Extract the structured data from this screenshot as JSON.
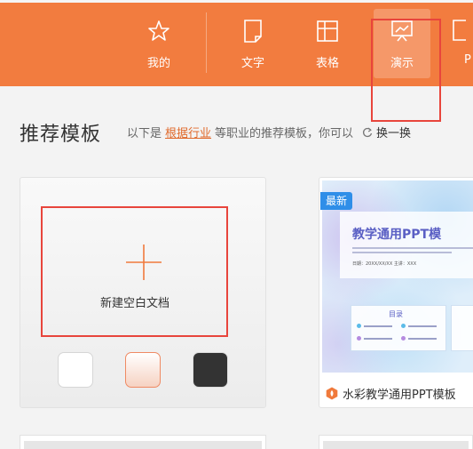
{
  "nav": {
    "items": [
      {
        "label": "我的",
        "icon": "star-icon"
      },
      {
        "label": "文字",
        "icon": "document-icon"
      },
      {
        "label": "表格",
        "icon": "table-icon"
      },
      {
        "label": "演示",
        "icon": "presentation-icon",
        "active": true
      },
      {
        "label": "P",
        "icon": "pdf-icon"
      }
    ]
  },
  "header": {
    "title": "推荐模板",
    "subtitle_prefix": "以下是",
    "subtitle_link": "根据行业",
    "subtitle_suffix": "等职业的推荐模板，你可以",
    "swap_label": "换一换"
  },
  "blank": {
    "label": "新建空白文档",
    "swatches": [
      "white",
      "peach",
      "dark"
    ]
  },
  "template": {
    "badge": "最新",
    "name": "水彩教学通用PPT模板",
    "slide_title": "教学通用PPT模",
    "slide_meta": "日期：20XX/XX/XX      主讲：XXX",
    "toc_title": "目录"
  },
  "colors": {
    "nav_bg": "#f27c3f",
    "accent": "#e06a2c",
    "badge": "#2f8ee8",
    "annotation_red": "#e8453c"
  }
}
